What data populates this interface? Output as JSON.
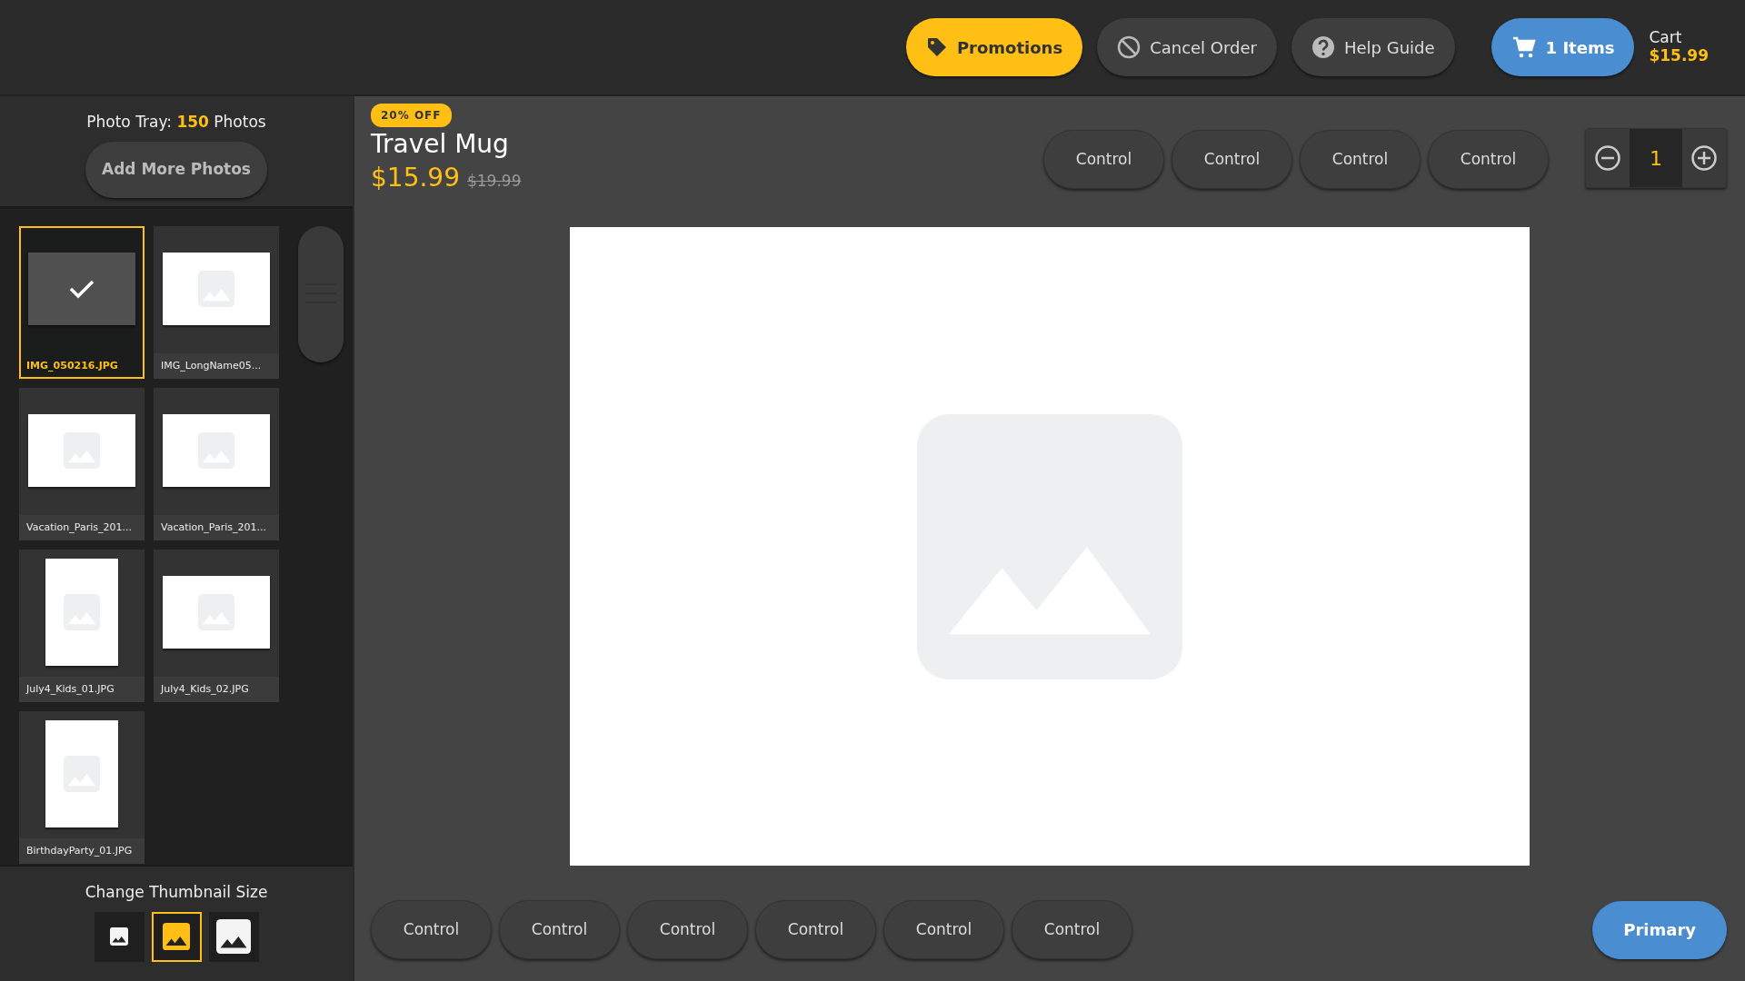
{
  "header": {
    "buttons": [
      {
        "kind": "promo",
        "label": "Promotions"
      },
      {
        "kind": "cancel",
        "label": "Cancel Order"
      },
      {
        "kind": "help",
        "label": "Help Guide"
      }
    ],
    "cart_button": "1 Items",
    "cart_label": "Cart",
    "cart_total": "$15.99"
  },
  "photo_tray": {
    "title": "Photo Tray: **150** Photos",
    "add_button": "Add More Photos",
    "photos": [
      {
        "name": "IMG_050216.JPG",
        "kind": "landscape",
        "selected": true
      },
      {
        "name": "IMG_LongName05...",
        "kind": "landscape",
        "selected": false
      },
      {
        "name": "Vacation_Paris_201...",
        "kind": "landscape",
        "selected": false
      },
      {
        "name": "Vacation_Paris_201...",
        "kind": "landscape",
        "selected": false
      },
      {
        "name": "July4_Kids_01.JPG",
        "kind": "portrait",
        "selected": false
      },
      {
        "name": "July4_Kids_02.JPG",
        "kind": "landscape",
        "selected": false
      },
      {
        "name": "BirthdayParty_01.JPG",
        "kind": "portrait",
        "selected": false
      }
    ],
    "thumbnail_size": {
      "title": "Change Thumbnail Size",
      "options": [
        {
          "kind": "small",
          "selected": false
        },
        {
          "kind": "medium",
          "selected": true
        },
        {
          "kind": "large",
          "selected": false
        }
      ]
    }
  },
  "product": {
    "badge": "20% OFF",
    "name": "Travel Mug",
    "price": "$15.99",
    "old_price": "$19.99",
    "controls": [
      "Control",
      "Control",
      "Control",
      "Control"
    ],
    "quantity": "1"
  },
  "bottom_controls": [
    "Control",
    "Control",
    "Control",
    "Control",
    "Control",
    "Control"
  ],
  "primary_button": "Primary"
}
